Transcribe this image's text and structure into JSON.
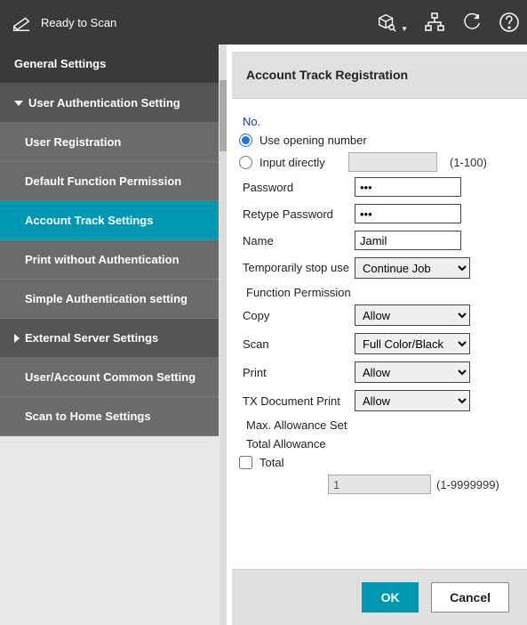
{
  "header": {
    "status": "Ready to Scan"
  },
  "sidebar": {
    "items": [
      {
        "label": "General Settings"
      },
      {
        "label": "User Authentication Setting"
      },
      {
        "label": "User Registration"
      },
      {
        "label": "Default Function Permission"
      },
      {
        "label": "Account Track Settings"
      },
      {
        "label": "Print without Authentication"
      },
      {
        "label": "Simple Authentication setting"
      },
      {
        "label": "External Server Settings"
      },
      {
        "label": "User/Account Common Setting"
      },
      {
        "label": "Scan to Home Settings"
      }
    ]
  },
  "main": {
    "title": "Account Track Registration",
    "no_label": "No.",
    "use_opening": "Use opening number",
    "input_directly": "Input directly",
    "input_directly_hint": "(1-100)",
    "password_label": "Password",
    "retype_password_label": "Retype Password",
    "password_value": "•••",
    "retype_value": "•••",
    "name_label": "Name",
    "name_value": "Jamil",
    "temp_stop_label": "Temporarily stop use",
    "temp_stop_value": "Continue Job",
    "func_perm_label": "Function Permission",
    "copy_label": "Copy",
    "copy_value": "Allow",
    "scan_label": "Scan",
    "scan_value": "Full Color/Black",
    "print_label": "Print",
    "print_value": "Allow",
    "txdoc_label": "TX Document Print",
    "txdoc_value": "Allow",
    "max_allowance_label": "Max. Allowance Set",
    "total_allowance_label": "Total Allowance",
    "total_checkbox_label": "Total",
    "total_value": "1",
    "total_hint": "(1-9999999)"
  },
  "footer": {
    "ok": "OK",
    "cancel": "Cancel"
  }
}
